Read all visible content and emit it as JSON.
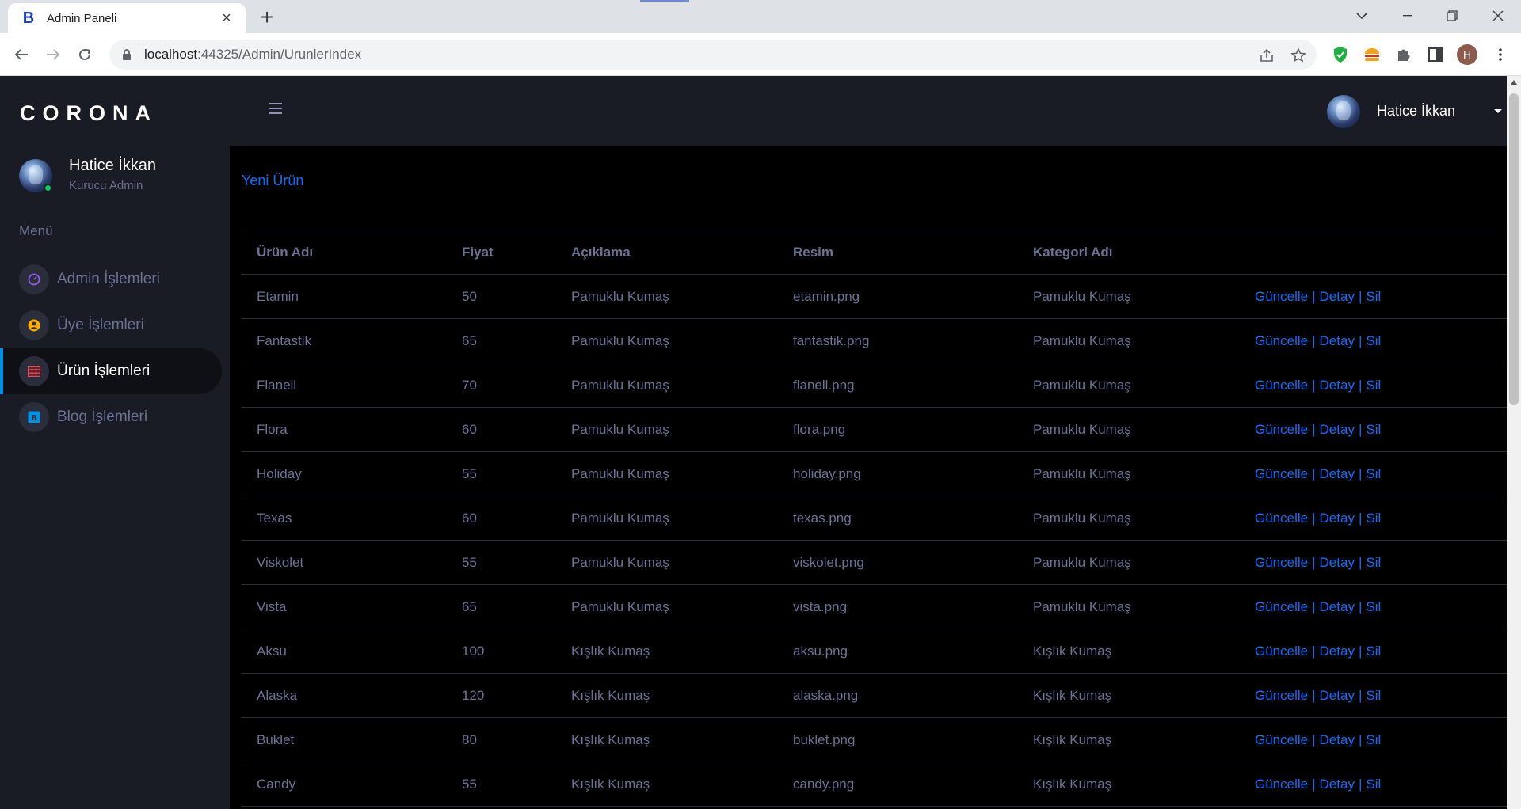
{
  "browser": {
    "tab_title": "Admin Paneli",
    "favicon_letter": "B",
    "url_host": "localhost",
    "url_rest": ":44325/Admin/UrunlerIndex",
    "profile_initial": "H"
  },
  "sidebar": {
    "brand": "CORONA",
    "user_name": "Hatice İkkan",
    "user_role": "Kurucu Admin",
    "menu_category": "Menü",
    "items": [
      {
        "label": "Admin İşlemleri",
        "icon": "speedometer-icon",
        "color": "#8f5fe8",
        "active": false
      },
      {
        "label": "Üye İşlemleri",
        "icon": "user-circle-icon",
        "color": "#ffab00",
        "active": false
      },
      {
        "label": "Ürün İşlemleri",
        "icon": "table-icon",
        "color": "#fc424a",
        "active": true
      },
      {
        "label": "Blog İşlemleri",
        "icon": "blog-icon",
        "color": "#0090e7",
        "active": false
      }
    ]
  },
  "topnav": {
    "user_name": "Hatice İkkan"
  },
  "content": {
    "new_product_link": "Yeni Ürün",
    "columns": [
      "Ürün Adı",
      "Fiyat",
      "Açıklama",
      "Resim",
      "Kategori Adı",
      ""
    ],
    "action_labels": {
      "update": "Güncelle",
      "detail": "Detay",
      "delete": "Sil",
      "separator": "|"
    },
    "rows": [
      {
        "name": "Etamin",
        "price": "50",
        "desc": "Pamuklu Kumaş",
        "image": "etamin.png",
        "category": "Pamuklu Kumaş"
      },
      {
        "name": "Fantastik",
        "price": "65",
        "desc": "Pamuklu Kumaş",
        "image": "fantastik.png",
        "category": "Pamuklu Kumaş"
      },
      {
        "name": "Flanell",
        "price": "70",
        "desc": "Pamuklu Kumaş",
        "image": "flanell.png",
        "category": "Pamuklu Kumaş"
      },
      {
        "name": "Flora",
        "price": "60",
        "desc": "Pamuklu Kumaş",
        "image": "flora.png",
        "category": "Pamuklu Kumaş"
      },
      {
        "name": "Holiday",
        "price": "55",
        "desc": "Pamuklu Kumaş",
        "image": "holiday.png",
        "category": "Pamuklu Kumaş"
      },
      {
        "name": "Texas",
        "price": "60",
        "desc": "Pamuklu Kumaş",
        "image": "texas.png",
        "category": "Pamuklu Kumaş"
      },
      {
        "name": "Viskolet",
        "price": "55",
        "desc": "Pamuklu Kumaş",
        "image": "viskolet.png",
        "category": "Pamuklu Kumaş"
      },
      {
        "name": "Vista",
        "price": "65",
        "desc": "Pamuklu Kumaş",
        "image": "vista.png",
        "category": "Pamuklu Kumaş"
      },
      {
        "name": "Aksu",
        "price": "100",
        "desc": "Kışlık Kumaş",
        "image": "aksu.png",
        "category": "Kışlık Kumaş"
      },
      {
        "name": "Alaska",
        "price": "120",
        "desc": "Kışlık Kumaş",
        "image": "alaska.png",
        "category": "Kışlık Kumaş"
      },
      {
        "name": "Buklet",
        "price": "80",
        "desc": "Kışlık Kumaş",
        "image": "buklet.png",
        "category": "Kışlık Kumaş"
      },
      {
        "name": "Candy",
        "price": "55",
        "desc": "Kışlık Kumaş",
        "image": "candy.png",
        "category": "Kışlık Kumaş"
      }
    ]
  },
  "colors": {
    "sidebar_bg": "#191c24",
    "content_bg": "#000000",
    "link": "#0d6efd",
    "muted_text": "#6c7293",
    "active_indicator": "#0090e7"
  }
}
